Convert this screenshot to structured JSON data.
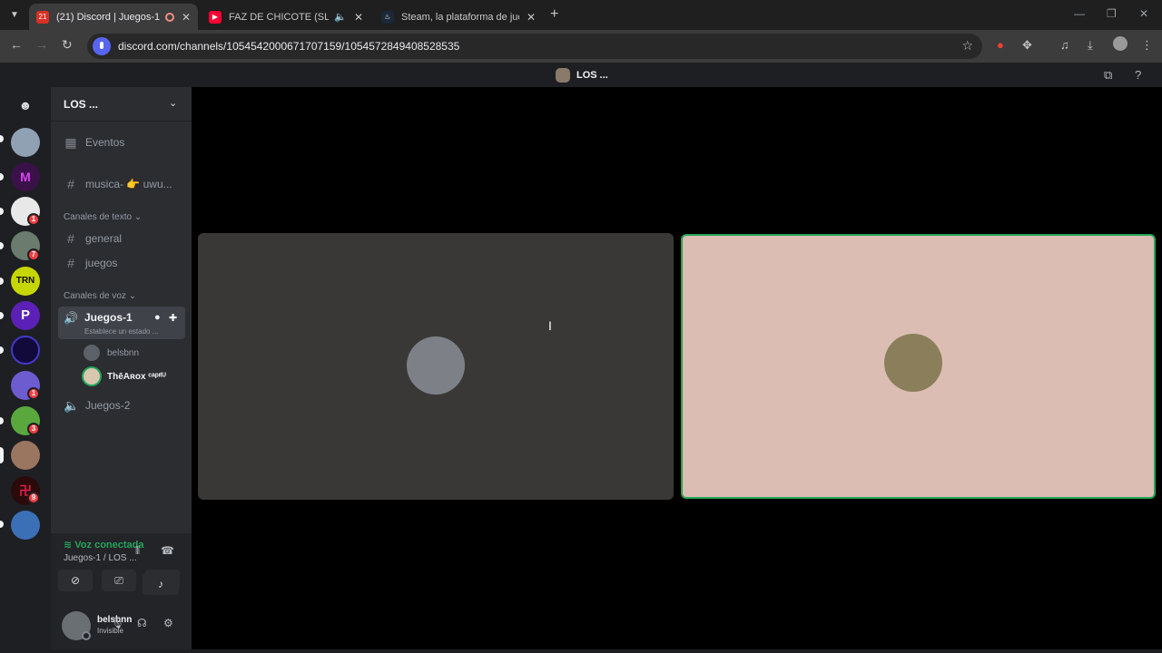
{
  "browser": {
    "tabs": [
      {
        "title": "(21) Discord | Juegos-1 | LOS",
        "favicon": "21"
      },
      {
        "title": "FAZ DE CHICOTE (SLOWED)",
        "favicon": "▶"
      },
      {
        "title": "Steam, la plataforma de juegos",
        "favicon": "♨"
      }
    ],
    "url": "discord.com/channels/1054542000671707159/1054572849408528535"
  },
  "top": {
    "title": "LOS ..."
  },
  "guild_badges": [
    "1",
    "7",
    "1",
    "3",
    "9"
  ],
  "server": {
    "name": "LOS ..."
  },
  "channels": {
    "events": "Eventos",
    "musica": "musica- 👉 uwu...",
    "text_category": "Canales de texto",
    "text_channels": [
      "general",
      "juegos"
    ],
    "voice_category": "Canales de voz",
    "voice_active": {
      "name": "Juegos-1",
      "status": "Establece un estado ..."
    },
    "voice_members": [
      "belsbnn",
      "ThēAʀox ᶜᵃᵖᶦᵗᵁ"
    ],
    "voice_other": "Juegos-2"
  },
  "panel": {
    "connected": "Voz conectada",
    "location": "Juegos-1 / LOS ...",
    "user": {
      "name": "belsbnn",
      "status": "Invisible"
    }
  },
  "colors": {
    "accent": "#5865f2",
    "speaking": "#23a55a",
    "tile_left": "#3a3836",
    "tile_right": "#dbbdb3"
  }
}
